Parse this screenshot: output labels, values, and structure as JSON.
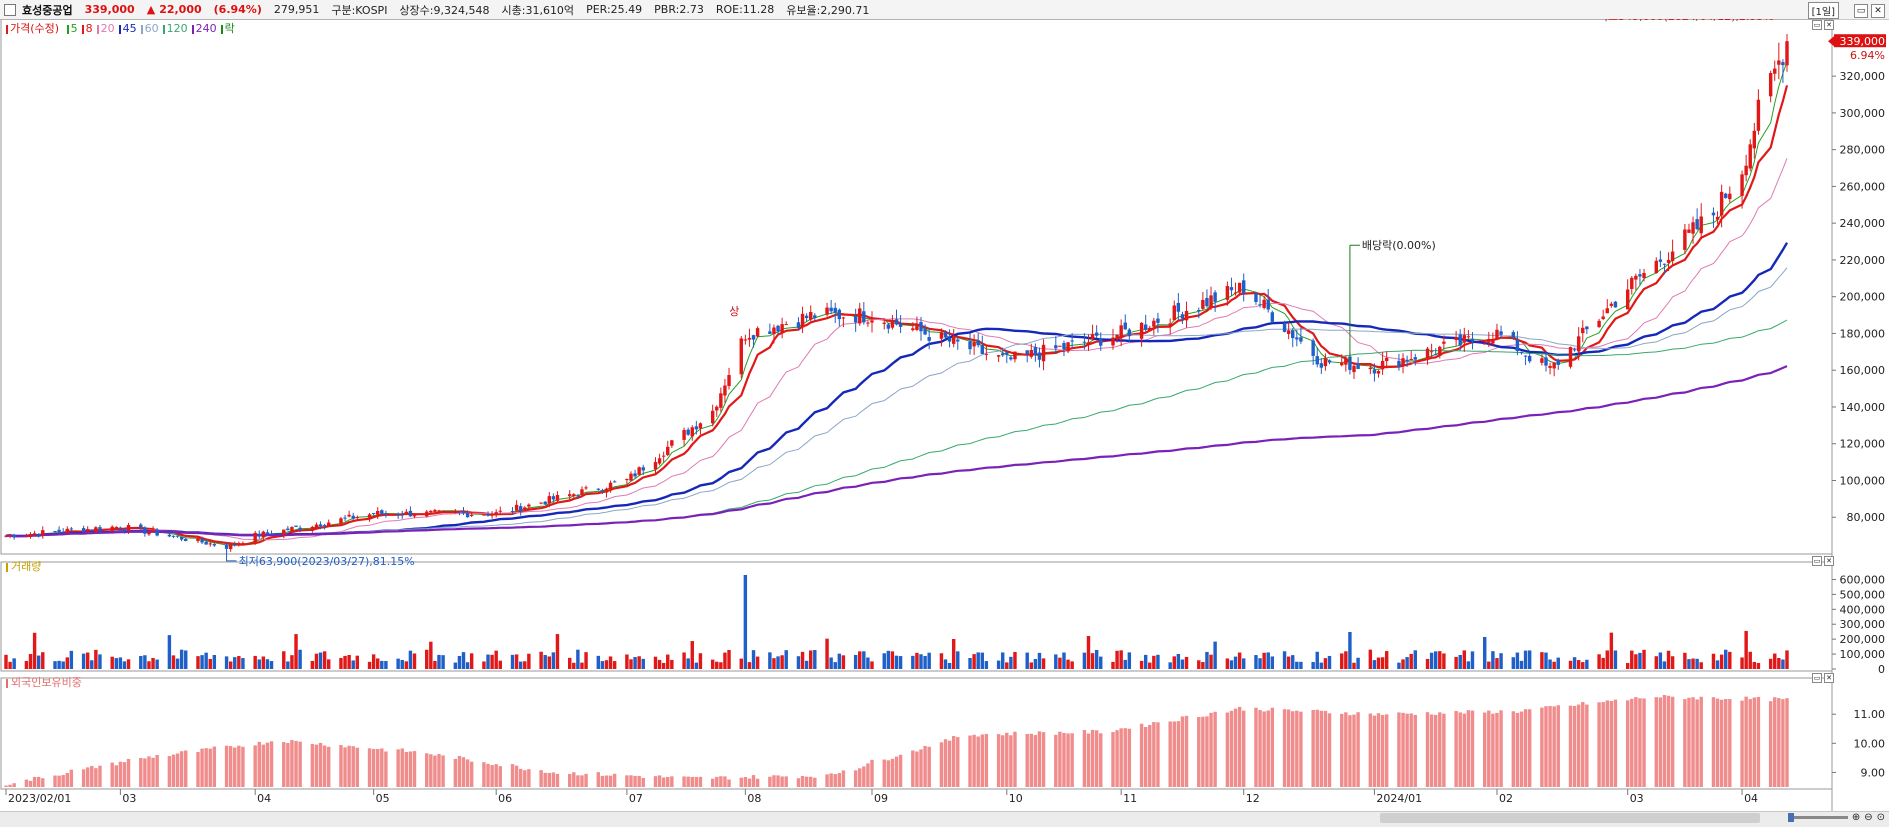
{
  "header": {
    "name": "효성중공업",
    "price": "339,000",
    "change_arrow": "▲",
    "change": "22,000",
    "change_pct": "(6.94%)",
    "volume": "279,951",
    "market": "구분:KOSPI",
    "shares": "상장수:9,324,548",
    "mcap": "시총:31,610억",
    "per": "PER:25.49",
    "pbr": "PBR:2.73",
    "roe": "ROE:11.28",
    "float": "유보율:2,290.71",
    "period": "[1일]"
  },
  "legend": {
    "price_label": "가격(수정)",
    "ma": [
      {
        "label": "5",
        "color": "#23a023"
      },
      {
        "label": "8",
        "color": "#e01818"
      },
      {
        "label": "20",
        "color": "#e07ab4"
      },
      {
        "label": "45",
        "color": "#1628b8"
      },
      {
        "label": "60",
        "color": "#8aa6c8"
      },
      {
        "label": "120",
        "color": "#3aa86e"
      },
      {
        "label": "240",
        "color": "#7a22b8"
      },
      {
        "label": "락",
        "color": "#1a8a1a"
      }
    ]
  },
  "annotations": {
    "high": "최고349,000(2024/04/12),2.95%",
    "low": "최저63,900(2023/03/27),81.15%",
    "dividend": "배당락(0.00%)",
    "upper_limit": "상",
    "current_price_tag": "339,000",
    "current_pct_tag": "6.94%"
  },
  "panels": {
    "volume_label": "거래량",
    "foreign_label": "외국인보유비중"
  },
  "axes": {
    "price_ticks": [
      "320,000",
      "300,000",
      "280,000",
      "260,000",
      "240,000",
      "220,000",
      "200,000",
      "180,000",
      "160,000",
      "140,000",
      "120,000",
      "100,000",
      "80,000"
    ],
    "volume_ticks": [
      "600,000",
      "500,000",
      "400,000",
      "300,000",
      "200,000",
      "100,000",
      "0"
    ],
    "foreign_ticks": [
      "11.00",
      "10.00",
      "9.00"
    ],
    "date_ticks": [
      "2023/02/01",
      "03",
      "04",
      "05",
      "06",
      "07",
      "08",
      "09",
      "10",
      "11",
      "12",
      "2024/01",
      "02",
      "03",
      "04"
    ]
  },
  "colors": {
    "up": "#e01818",
    "down": "#1f5fc8",
    "foreign_bar": "#f08c8c",
    "ma45": "#1628b8",
    "ma240": "#7a22b8"
  },
  "chart_data": [
    {
      "type": "line",
      "title": "",
      "series": [
        {
          "name": "가격(수정)",
          "x": [
            "2023/02/01",
            "2023/03/01",
            "2023/03/27",
            "2023/04/03",
            "2023/05/02",
            "2023/06/01",
            "2023/07/03",
            "2023/07/24",
            "2023/08/01",
            "2023/08/18",
            "2023/09/01",
            "2023/10/04",
            "2023/11/01",
            "2023/12/01",
            "2023/12/20",
            "2024/01/02",
            "2024/02/01",
            "2024/02/14",
            "2024/03/04",
            "2024/03/25",
            "2024/04/01",
            "2024/04/05",
            "2024/04/12"
          ],
          "values": [
            70000,
            75000,
            63900,
            70000,
            82000,
            82000,
            100000,
            138000,
            180000,
            190000,
            190000,
            165000,
            180000,
            205000,
            165000,
            162000,
            180000,
            160000,
            205000,
            245000,
            270000,
            300000,
            339000
          ]
        }
      ],
      "ylim": [
        60000,
        350000
      ],
      "ylabel": "",
      "x_tick_labels": [
        "2023/02/01",
        "03",
        "04",
        "05",
        "06",
        "07",
        "08",
        "09",
        "10",
        "11",
        "12",
        "2024/01",
        "02",
        "03",
        "04"
      ],
      "grid": true
    },
    {
      "type": "bar",
      "title": "거래량",
      "values_note": "",
      "categories": [
        "2023/07",
        "2023/08-peak",
        "2023/12",
        "2024/03",
        "2024/04"
      ],
      "values": [
        270000,
        630000,
        280000,
        240000,
        280000
      ],
      "ylim": [
        0,
        650000
      ]
    },
    {
      "type": "bar",
      "title": "외국인보유비중",
      "categories": [
        "2023/02",
        "2023/04",
        "2023/05",
        "2023/06",
        "2023/07",
        "2023/08",
        "2023/09",
        "2023/10",
        "2023/11",
        "2023/12",
        "2024/01",
        "2024/02",
        "2024/03",
        "2024/04"
      ],
      "values": [
        8.6,
        9.5,
        10.1,
        9.7,
        9.0,
        8.8,
        8.9,
        10.3,
        10.4,
        11.2,
        11.0,
        11.1,
        11.6,
        11.5
      ],
      "ylim": [
        8.5,
        11.9
      ]
    }
  ]
}
